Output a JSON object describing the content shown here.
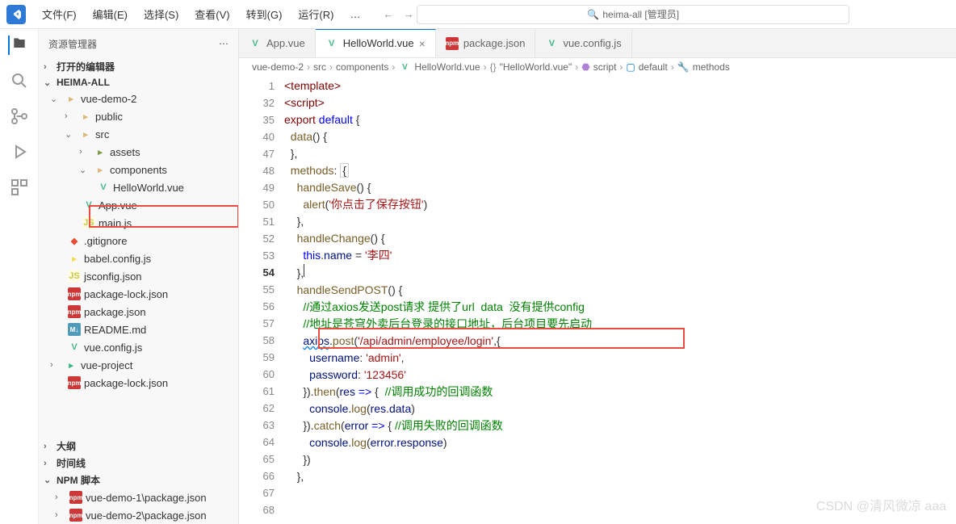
{
  "menubar": [
    "文件(F)",
    "编辑(E)",
    "选择(S)",
    "查看(V)",
    "转到(G)",
    "运行(R)",
    "…"
  ],
  "search_placeholder": "heima-all [管理员]",
  "sidebar": {
    "title": "资源管理器",
    "open_editors": "打开的编辑器",
    "project": "HEIMA-ALL",
    "tree": {
      "vue_demo_2": "vue-demo-2",
      "public": "public",
      "src": "src",
      "assets": "assets",
      "components": "components",
      "helloworld": "HelloWorld.vue",
      "app_vue": "App.vue",
      "main_js": "main.js",
      "gitignore": ".gitignore",
      "babel": "babel.config.js",
      "jsconfig": "jsconfig.json",
      "pkg_lock": "package-lock.json",
      "pkg": "package.json",
      "readme": "README.md",
      "vue_config": "vue.config.js",
      "vue_project": "vue-project",
      "pkg_lock2": "package-lock.json"
    },
    "outline": "大纲",
    "timeline": "时间线",
    "npm_scripts": "NPM 脚本",
    "npm_items": [
      "vue-demo-1\\package.json",
      "vue-demo-2\\package.json"
    ]
  },
  "tabs": [
    {
      "icon": "vue",
      "label": "App.vue",
      "active": false
    },
    {
      "icon": "vue",
      "label": "HelloWorld.vue",
      "active": true
    },
    {
      "icon": "npm",
      "label": "package.json",
      "active": false
    },
    {
      "icon": "vue",
      "label": "vue.config.js",
      "active": false
    }
  ],
  "breadcrumbs": [
    "vue-demo-2",
    "src",
    "components",
    "HelloWorld.vue",
    "\"HelloWorld.vue\"",
    "script",
    "default",
    "methods"
  ],
  "line_numbers": [
    "1",
    "32",
    "35",
    "40",
    "47",
    "48",
    "49",
    "50",
    "51",
    "52",
    "53",
    "54",
    "55",
    "56",
    "57",
    "58",
    "59",
    "60",
    "61",
    "62",
    "63",
    "64",
    "65",
    "66",
    "67",
    "68"
  ],
  "code": {
    "l1": {
      "tag": "<template>"
    },
    "l32": {
      "tag": "<script>"
    },
    "l35a": "export",
    "l35b": " default",
    "l35c": " {",
    "l40a": "data",
    "l40b": "() {",
    "l47": "},",
    "l48a": "methods",
    "l48b": ": ",
    "l48c": "{",
    "l49a": "handleSave",
    "l49b": "() {",
    "l50a": "alert",
    "l50b": "(",
    "l50c": "'你点击了保存按钮'",
    "l50d": ")",
    "l51": "},",
    "l52a": "handleChange",
    "l52b": "() {",
    "l53a": "this",
    "l53b": ".",
    "l53c": "name",
    "l53d": " = ",
    "l53e": "'李四'",
    "l54": "},",
    "l55a": "handleSendPOST",
    "l55b": "() {",
    "l56": "//通过axios发送post请求 提供了url  data  没有提供config",
    "l57": "//地址是苍穹外卖后台登录的接口地址，后台项目要先启动",
    "l58a": "axios",
    "l58b": ".",
    "l58c": "post",
    "l58d": "(",
    "l58e": "'/api/admin/employee/login'",
    "l58f": ",{",
    "l59a": "username",
    "l59b": ": ",
    "l59c": "'admin'",
    "l59d": ",",
    "l60a": "password",
    "l60b": ": ",
    "l60c": "'123456'",
    "l61a": "}).",
    "l61b": "then",
    "l61c": "(",
    "l61d": "res",
    "l61e": " => ",
    "l61f": "{  ",
    "l61g": "//调用成功的回调函数",
    "l62a": "console",
    "l62b": ".",
    "l62c": "log",
    "l62d": "(",
    "l62e": "res",
    "l62f": ".",
    "l62g": "data",
    "l62h": ")",
    "l63a": "}).",
    "l63b": "catch",
    "l63c": "(",
    "l63d": "error",
    "l63e": " => ",
    "l63f": "{ ",
    "l63g": "//调用失败的回调函数",
    "l64a": "console",
    "l64b": ".",
    "l64c": "log",
    "l64d": "(",
    "l64e": "error",
    "l64f": ".",
    "l64g": "response",
    "l64h": ")",
    "l65": "})",
    "l66": "},"
  },
  "watermark": "CSDN @清风微凉 aaa"
}
